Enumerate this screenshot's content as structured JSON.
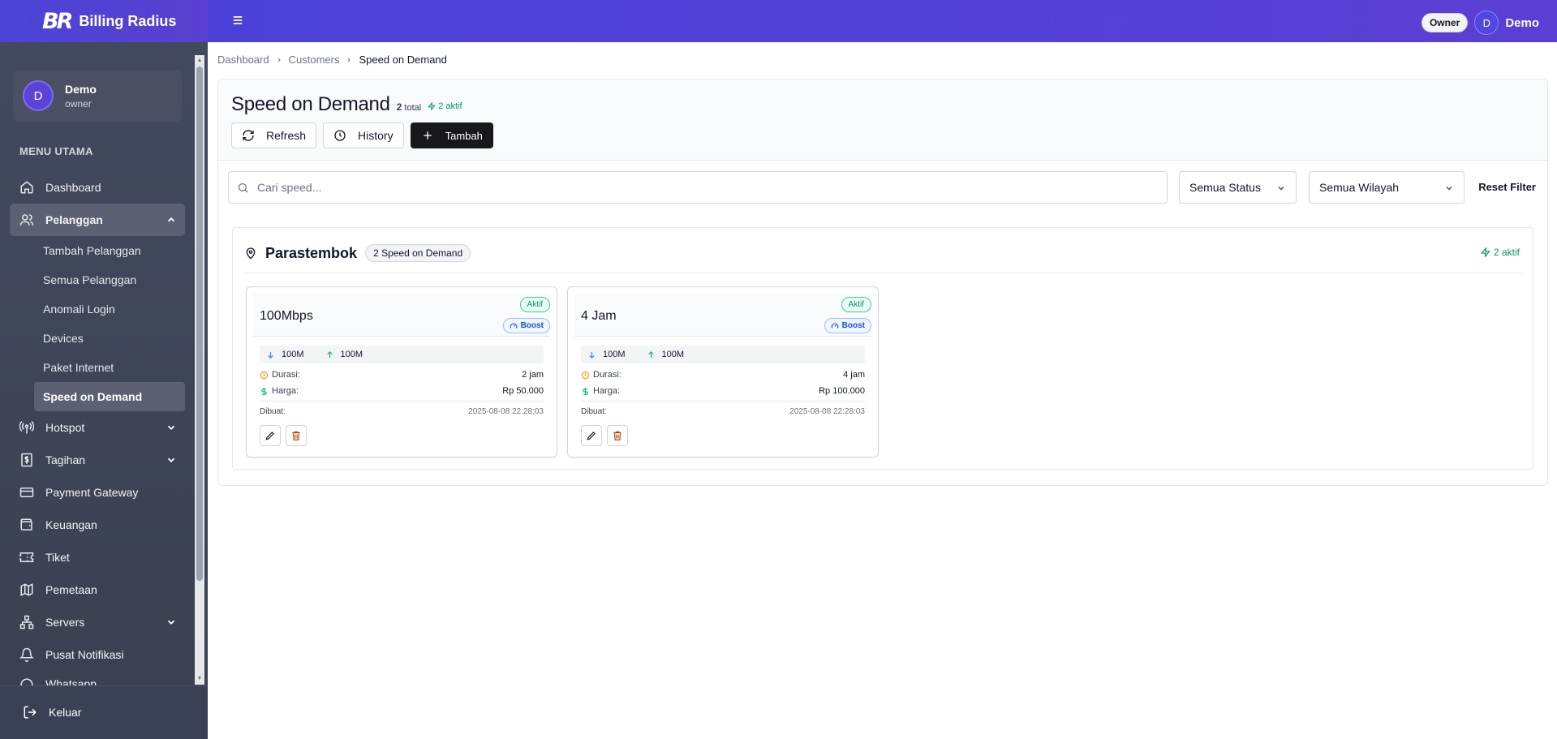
{
  "app": {
    "logo_text": "BR",
    "brand": "Billing Radius"
  },
  "user": {
    "initial": "D",
    "name": "Demo",
    "role": "owner",
    "badge": "Owner"
  },
  "sidebar": {
    "section_title": "MENU UTAMA",
    "items": [
      {
        "label": "Dashboard",
        "icon": "home-icon"
      },
      {
        "label": "Pelanggan",
        "icon": "users-icon",
        "expanded": true,
        "children": [
          "Tambah Pelanggan",
          "Semua Pelanggan",
          "Anomali Login",
          "Devices",
          "Paket Internet",
          "Speed on Demand"
        ]
      },
      {
        "label": "Hotspot",
        "icon": "antenna-icon"
      },
      {
        "label": "Tagihan",
        "icon": "receipt-icon"
      },
      {
        "label": "Payment Gateway",
        "icon": "credit-card-icon"
      },
      {
        "label": "Keuangan",
        "icon": "wallet-icon"
      },
      {
        "label": "Tiket",
        "icon": "ticket-icon"
      },
      {
        "label": "Pemetaan",
        "icon": "map-icon"
      },
      {
        "label": "Servers",
        "icon": "network-icon"
      },
      {
        "label": "Pusat Notifikasi",
        "icon": "bell-icon"
      },
      {
        "label": "Whatsapp",
        "icon": "chat-icon"
      }
    ],
    "active_child": "Speed on Demand",
    "logout": "Keluar"
  },
  "breadcrumb": [
    "Dashboard",
    "Customers",
    "Speed on Demand"
  ],
  "page": {
    "title": "Speed on Demand",
    "total_count": "2",
    "total_label": "total",
    "active_label": "2 aktif",
    "buttons": {
      "refresh": "Refresh",
      "history": "History",
      "add": "Tambah"
    }
  },
  "filters": {
    "search_placeholder": "Cari speed...",
    "status": "Semua Status",
    "region": "Semua Wilayah",
    "reset": "Reset Filter"
  },
  "group": {
    "name": "Parastembok",
    "count_pill": "2 Speed on Demand",
    "active": "2 aktif",
    "cards": [
      {
        "name": "100Mbps",
        "status": "Aktif",
        "type": "Boost",
        "down": "100M",
        "up": "100M",
        "duration_label": "Durasi:",
        "duration": "2 jam",
        "price_label": "Harga:",
        "price": "Rp 50.000",
        "created_label": "Dibuat:",
        "created": "2025-08-08 22:28:03"
      },
      {
        "name": "4 Jam",
        "status": "Aktif",
        "type": "Boost",
        "down": "100M",
        "up": "100M",
        "duration_label": "Durasi:",
        "duration": "4 jam",
        "price_label": "Harga:",
        "price": "Rp 100.000",
        "created_label": "Dibuat:",
        "created": "2025-08-08 22:28:03"
      }
    ]
  },
  "colors": {
    "topbar": "#4a40d8",
    "sidebar": "#434a5e",
    "accent_green": "#059669",
    "accent_blue": "#1d4ed8"
  }
}
